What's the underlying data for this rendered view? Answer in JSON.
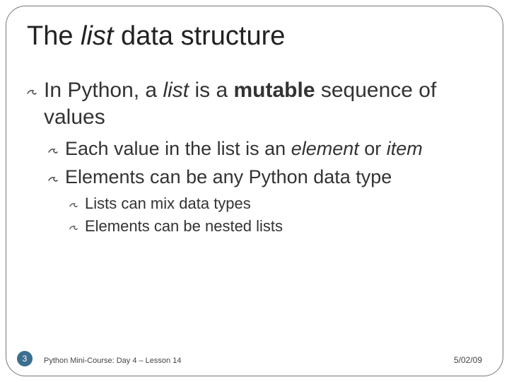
{
  "title": {
    "pre": "The ",
    "italic": "list",
    "post": " data structure"
  },
  "bullets": {
    "l1_a_pre": "In Python, a ",
    "l1_a_italic": "list",
    "l1_a_mid": " is a ",
    "l1_a_bold": "mutable",
    "l1_a_post": " sequence of values",
    "l2_a_pre": "Each value in the list is an ",
    "l2_a_italic1": "element",
    "l2_a_mid": " or ",
    "l2_a_italic2": "item",
    "l2_b": "Elements can be any Python data type",
    "l3_a": "Lists can mix data types",
    "l3_b": "Elements can be nested lists"
  },
  "footer": {
    "page": "3",
    "course": "Python Mini-Course: Day 4 – Lesson 14",
    "date": "5/02/09"
  }
}
